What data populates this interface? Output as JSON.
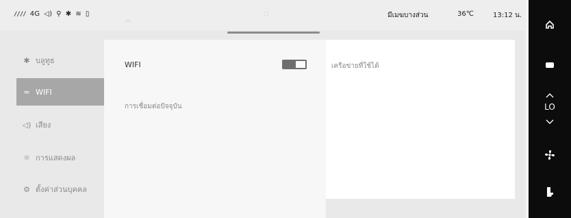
{
  "status_bar": {
    "signal": "////",
    "network": "4G",
    "volume_icon": "speaker-icon",
    "usb_icon": "usb-icon",
    "bluetooth_icon": "bluetooth-icon",
    "wifi_icon": "wifi-icon",
    "phone_icon": "phone-icon",
    "weather_text": "มีเมฆบางส่วน",
    "temperature": "36℃",
    "time": "13:12 น."
  },
  "sidebar": {
    "items": [
      {
        "label": "บลูทูธ",
        "icon": "bluetooth-icon",
        "icon_glyph": "✱",
        "active": false
      },
      {
        "label": "WIFI",
        "icon": "wifi-icon",
        "icon_glyph": "≈",
        "active": true
      },
      {
        "label": "เสียง",
        "icon": "speaker-icon",
        "icon_glyph": "◁)",
        "active": false
      },
      {
        "label": "การแสดงผล",
        "icon": "brightness-icon",
        "icon_glyph": "☼",
        "active": false
      },
      {
        "label": "ตั้งค่าส่วนบุคคล",
        "icon": "personal-settings-icon",
        "icon_glyph": "⚙",
        "active": false
      }
    ]
  },
  "wifi_panel": {
    "wifi_label": "WIFI",
    "wifi_enabled": true,
    "current_connection_label": "การเชื่อมต่อปัจจุบัน",
    "available_networks_label": "เครือข่ายที่ใช้ได้"
  },
  "right_rail": {
    "climate_level": "LO",
    "items": [
      "home-icon",
      "ac-display-icon",
      "chevron-up-icon",
      "chevron-down-icon",
      "fan-icon",
      "seat-icon"
    ]
  },
  "colors": {
    "active_item_bg": "#a7a7a7",
    "rail_bg": "#0c0c0c",
    "toggle_on": "#6e6e6e"
  }
}
